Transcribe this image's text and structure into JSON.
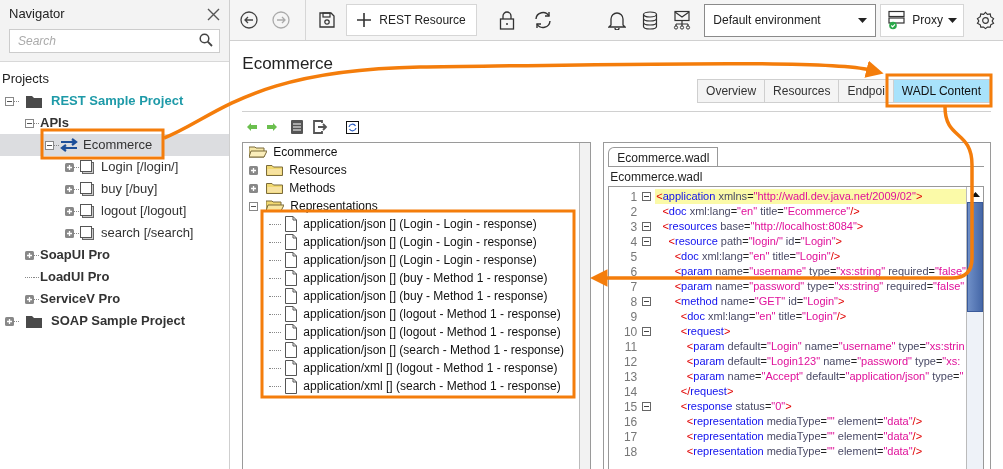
{
  "navigator": {
    "title": "Navigator",
    "search": {
      "placeholder": "Search"
    },
    "section": "Projects",
    "tree": [
      {
        "label": "REST Sample Project",
        "kind": "project",
        "current": true,
        "expanded": true,
        "selected": false,
        "children": [
          {
            "label": "APIs",
            "kind": "group",
            "expanded": true,
            "selected": false,
            "children": [
              {
                "label": "Ecommerce",
                "kind": "api",
                "expanded": true,
                "selected": true,
                "children": [
                  {
                    "label": "Login [/login/]",
                    "kind": "resource",
                    "expanded": false,
                    "selected": false
                  },
                  {
                    "label": "buy [/buy]",
                    "kind": "resource",
                    "expanded": false,
                    "selected": false
                  },
                  {
                    "label": "logout [/logout]",
                    "kind": "resource",
                    "expanded": false,
                    "selected": false
                  },
                  {
                    "label": "search [/search]",
                    "kind": "resource",
                    "expanded": false,
                    "selected": false
                  }
                ]
              }
            ]
          },
          {
            "label": "SoapUI Pro",
            "kind": "group",
            "expanded": false,
            "selected": false
          },
          {
            "label": "LoadUI Pro",
            "kind": "group",
            "selected": false
          },
          {
            "label": "ServiceV Pro",
            "kind": "group",
            "expanded": false,
            "selected": false
          }
        ]
      },
      {
        "label": "SOAP Sample Project",
        "kind": "project",
        "current": false,
        "expanded": false,
        "selected": false
      }
    ]
  },
  "toolbar": {
    "add_button": "REST Resource",
    "environment": "Default environment",
    "proxy": "Proxy",
    "forward_disabled": true
  },
  "editor": {
    "title": "Ecommerce",
    "tabs": [
      {
        "label": "Overview",
        "selected": false
      },
      {
        "label": "Resources",
        "selected": false
      },
      {
        "label": "Endpoi",
        "selected": false
      },
      {
        "label": "WADL Content",
        "selected": true
      }
    ],
    "outline": [
      {
        "label": "Ecommerce",
        "kind": "root",
        "expanded": true,
        "children": [
          {
            "label": "Resources",
            "kind": "folder",
            "expanded": false
          },
          {
            "label": "Methods",
            "kind": "folder",
            "expanded": false
          },
          {
            "label": "Representations",
            "kind": "folder",
            "expanded": true,
            "children": [
              {
                "label": "application/json [] (Login - Login - response)",
                "kind": "doc"
              },
              {
                "label": "application/json [] (Login - Login - response)",
                "kind": "doc"
              },
              {
                "label": "application/json [] (Login - Login - response)",
                "kind": "doc"
              },
              {
                "label": "application/json [] (buy - Method 1 - response)",
                "kind": "doc"
              },
              {
                "label": "application/json [] (buy - Method 1 - response)",
                "kind": "doc"
              },
              {
                "label": "application/json [] (logout - Method 1 - response)",
                "kind": "doc"
              },
              {
                "label": "application/json [] (logout - Method 1 - response)",
                "kind": "doc"
              },
              {
                "label": "application/json [] (search - Method 1 - response)",
                "kind": "doc"
              },
              {
                "label": "application/xml [] (logout - Method 1 - response)",
                "kind": "doc"
              },
              {
                "label": "application/xml [] (search - Method 1 - response)",
                "kind": "doc"
              }
            ]
          }
        ]
      }
    ],
    "file_tab": "Ecommerce.wadl",
    "file_label": "Ecommerce.wadl",
    "code": [
      {
        "number": "1",
        "foldable": true,
        "highlighted": true,
        "text": "<application xmlns=\"http://wadl.dev.java.net/2009/02\">"
      },
      {
        "number": "2",
        "foldable": false,
        "highlighted": false,
        "text": "  <doc xml:lang=\"en\" title=\"Ecommerce\"/>"
      },
      {
        "number": "3",
        "foldable": true,
        "highlighted": false,
        "text": "  <resources base=\"http://localhost:8084\">"
      },
      {
        "number": "4",
        "foldable": true,
        "highlighted": false,
        "text": "    <resource path=\"login/\" id=\"Login\">"
      },
      {
        "number": "5",
        "foldable": false,
        "highlighted": false,
        "text": "      <doc xml:lang=\"en\" title=\"Login\"/>"
      },
      {
        "number": "6",
        "foldable": false,
        "highlighted": false,
        "text": "      <param name=\"username\" type=\"xs:string\" required=\"false\""
      },
      {
        "number": "7",
        "foldable": false,
        "highlighted": false,
        "text": "      <param name=\"password\" type=\"xs:string\" required=\"false\""
      },
      {
        "number": "8",
        "foldable": true,
        "highlighted": false,
        "text": "      <method name=\"GET\" id=\"Login\">"
      },
      {
        "number": "9",
        "foldable": false,
        "highlighted": false,
        "text": "        <doc xml:lang=\"en\" title=\"Login\"/>"
      },
      {
        "number": "10",
        "foldable": true,
        "highlighted": false,
        "text": "        <request>"
      },
      {
        "number": "11",
        "foldable": false,
        "highlighted": false,
        "text": "          <param default=\"Login\" name=\"username\" type=\"xs:strin"
      },
      {
        "number": "12",
        "foldable": false,
        "highlighted": false,
        "text": "          <param default=\"Login123\" name=\"password\" type=\"xs:"
      },
      {
        "number": "13",
        "foldable": false,
        "highlighted": false,
        "text": "          <param name=\"Accept\" default=\"application/json\" type=\""
      },
      {
        "number": "14",
        "foldable": false,
        "highlighted": false,
        "text": "        </request>"
      },
      {
        "number": "15",
        "foldable": true,
        "highlighted": false,
        "text": "        <response status=\"0\">"
      },
      {
        "number": "16",
        "foldable": false,
        "highlighted": false,
        "text": "          <representation mediaType=\"\" element=\"data\"/>"
      },
      {
        "number": "17",
        "foldable": false,
        "highlighted": false,
        "text": "          <representation mediaType=\"\" element=\"data\"/>"
      },
      {
        "number": "18",
        "foldable": false,
        "highlighted": false,
        "text": "          <representation mediaType=\"\" element=\"data\"/>"
      }
    ]
  }
}
